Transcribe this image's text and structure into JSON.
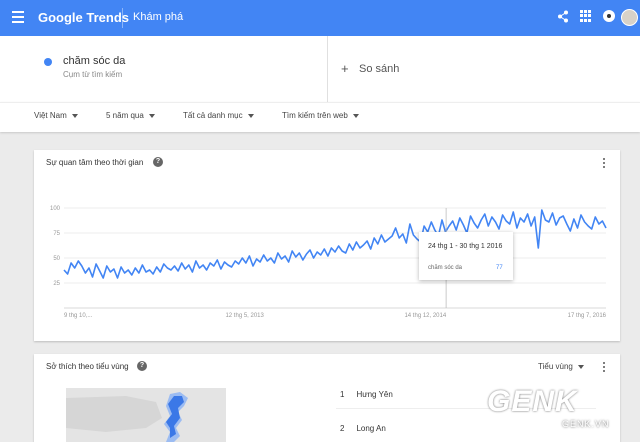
{
  "header": {
    "logo": "Google Trends",
    "section": "Khám phá"
  },
  "search": {
    "term": "chăm sóc da",
    "term_type": "Cụm từ tìm kiếm",
    "compare_plus": "+",
    "compare_label": "So sánh",
    "term_color": "#4285f4"
  },
  "filters": [
    {
      "label": "Việt Nam"
    },
    {
      "label": "5 năm qua"
    },
    {
      "label": "Tất cả danh mục"
    },
    {
      "label": "Tìm kiếm trên web"
    }
  ],
  "interest_card": {
    "title": "Sự quan tâm theo thời gian",
    "help": "?"
  },
  "chart_data": {
    "type": "line",
    "title": "",
    "xlabel": "",
    "ylabel": "",
    "ylim": [
      0,
      100
    ],
    "yticks": [
      "100",
      "75",
      "50",
      "25"
    ],
    "x_tick_labels": [
      "9 thg 10,...",
      "12 thg 5, 2013",
      "14 thg 12, 2014",
      "17 thg 7, 2016"
    ],
    "grid": true,
    "series": [
      {
        "color": "#4285f4",
        "values": [
          38,
          34,
          45,
          40,
          47,
          42,
          35,
          40,
          31,
          44,
          37,
          30,
          42,
          36,
          39,
          30,
          41,
          35,
          38,
          33,
          40,
          35,
          43,
          36,
          38,
          34,
          41,
          36,
          44,
          40,
          38,
          42,
          37,
          45,
          39,
          43,
          36,
          47,
          40,
          43,
          38,
          45,
          42,
          48,
          39,
          46,
          43,
          41,
          47,
          44,
          50,
          45,
          52,
          42,
          49,
          46,
          53,
          47,
          50,
          45,
          55,
          49,
          52,
          46,
          57,
          51,
          55,
          48,
          54,
          58,
          50,
          56,
          53,
          59,
          52,
          60,
          56,
          62,
          57,
          55,
          64,
          58,
          66,
          60,
          63,
          67,
          59,
          70,
          64,
          73,
          66,
          69,
          72,
          80,
          70,
          74,
          65,
          84,
          73,
          69,
          66,
          82,
          76,
          86,
          78,
          72,
          88,
          76,
          82,
          87,
          78,
          90,
          83,
          75,
          92,
          85,
          80,
          88,
          94,
          82,
          91,
          86,
          79,
          93,
          87,
          84,
          96,
          80,
          90,
          86,
          94,
          82,
          91,
          60,
          98,
          88,
          86,
          95,
          83,
          90,
          92,
          84,
          77,
          89,
          80,
          93,
          86,
          82,
          79,
          91,
          84,
          87,
          80
        ]
      }
    ]
  },
  "tooltip": {
    "date": "24 thg 1 - 30 thg 1 2016",
    "term": "chăm sóc da",
    "value": "77"
  },
  "region_card": {
    "title": "Sở thích theo tiểu vùng",
    "help": "?",
    "resolution": "Tiểu vùng",
    "rows": [
      {
        "rank": "1",
        "name": "Hưng Yên"
      },
      {
        "rank": "2",
        "name": "Long An"
      }
    ]
  },
  "watermark": {
    "main": "GENK",
    "sub": "GENK.VN"
  }
}
